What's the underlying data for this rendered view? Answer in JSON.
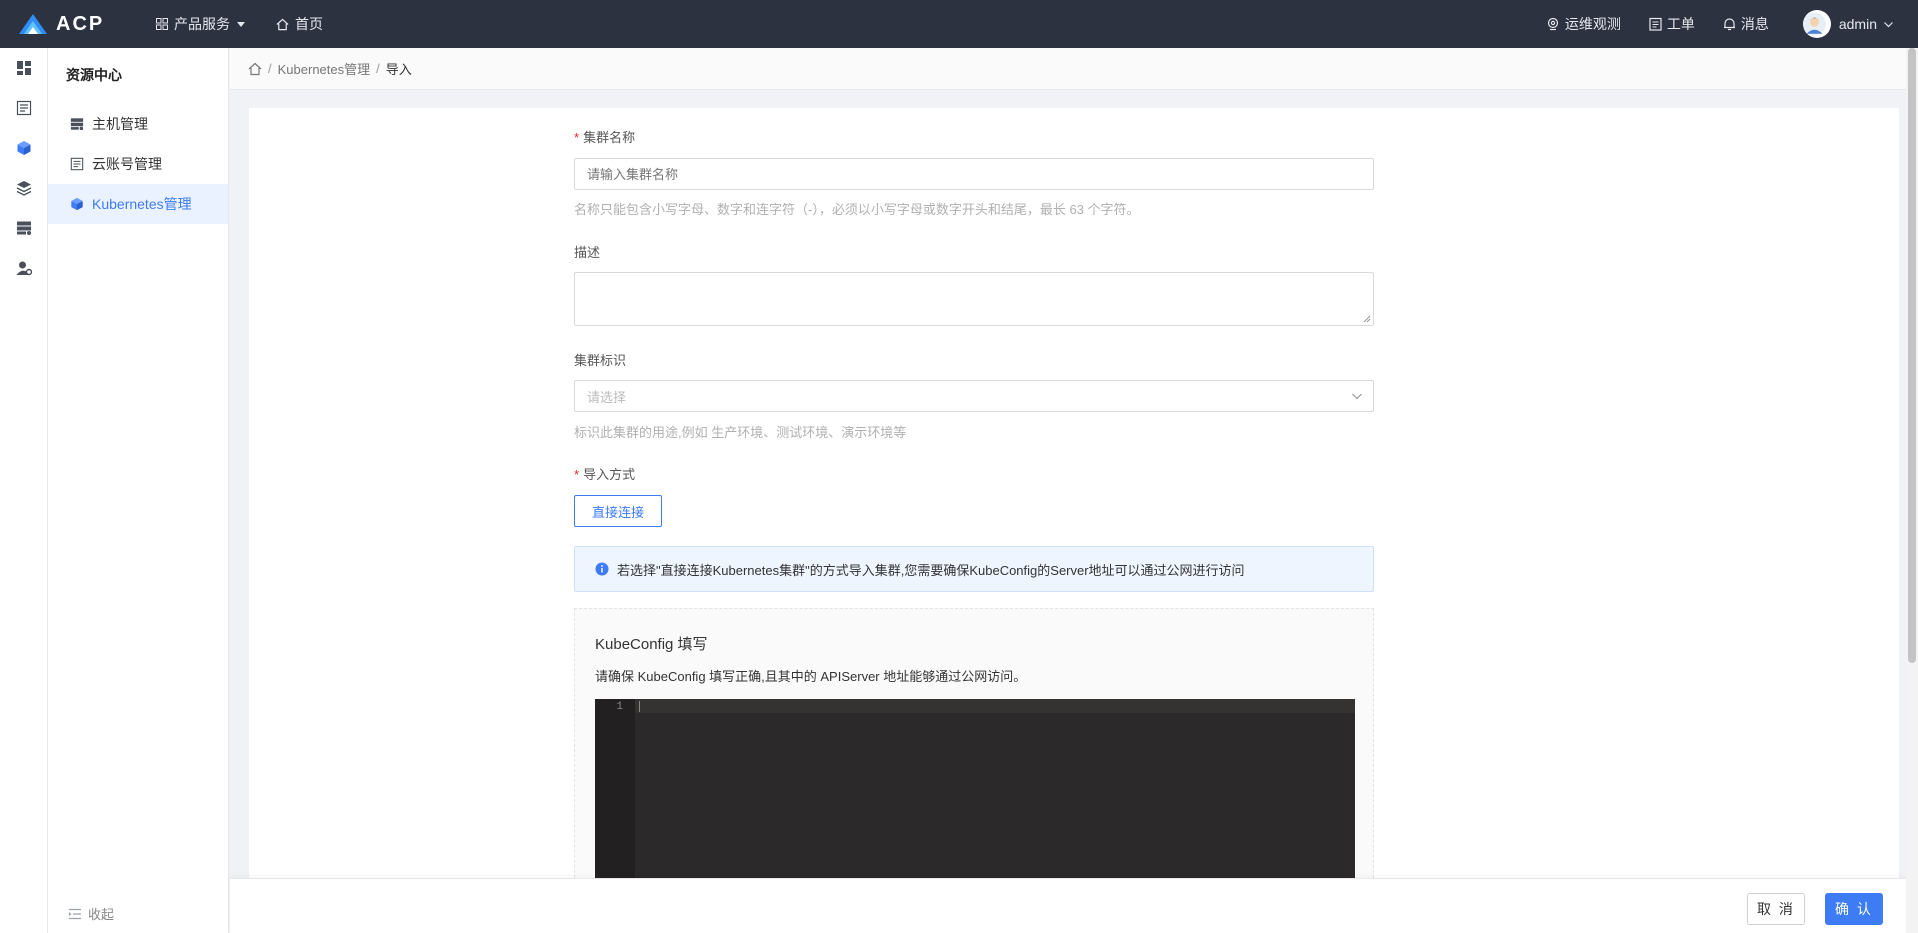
{
  "app": {
    "logo_text": "ACP"
  },
  "topnav": {
    "products_label": "产品服务",
    "home_label": "首页"
  },
  "topright": {
    "ops_label": "运维观测",
    "ticket_label": "工单",
    "message_label": "消息",
    "user_label": "admin"
  },
  "sidemenu": {
    "title": "资源中心",
    "items": [
      {
        "label": "主机管理"
      },
      {
        "label": "云账号管理"
      },
      {
        "label": "Kubernetes管理"
      }
    ],
    "collapse_label": "收起"
  },
  "breadcrumb": {
    "items": [
      "Kubernetes管理",
      "导入"
    ]
  },
  "form": {
    "cluster_name_label": "集群名称",
    "cluster_name_placeholder": "请输入集群名称",
    "cluster_name_help": "名称只能包含小写字母、数字和连字符（-），必须以小写字母或数字开头和结尾，最长 63 个字符。",
    "description_label": "描述",
    "cluster_tag_label": "集群标识",
    "cluster_tag_placeholder": "请选择",
    "cluster_tag_help": "标识此集群的用途,例如 生产环境、测试环境、演示环境等",
    "import_method_label": "导入方式",
    "import_method_option": "直接连接",
    "alert_text": "若选择\"直接连接Kubernetes集群\"的方式导入集群,您需要确保KubeConfig的Server地址可以通过公网进行访问",
    "kubeconfig_title": "KubeConfig 填写",
    "kubeconfig_desc": "请确保 KubeConfig 填写正确,且其中的 APIServer 地址能够通过公网访问。",
    "editor_line": "1"
  },
  "footer": {
    "cancel_label": "取 消",
    "confirm_label": "确 认"
  },
  "colors": {
    "topbar": "#2d3241",
    "accent": "#3d7cf5",
    "required": "#f5222d",
    "editor_bg": "#2b2929"
  }
}
